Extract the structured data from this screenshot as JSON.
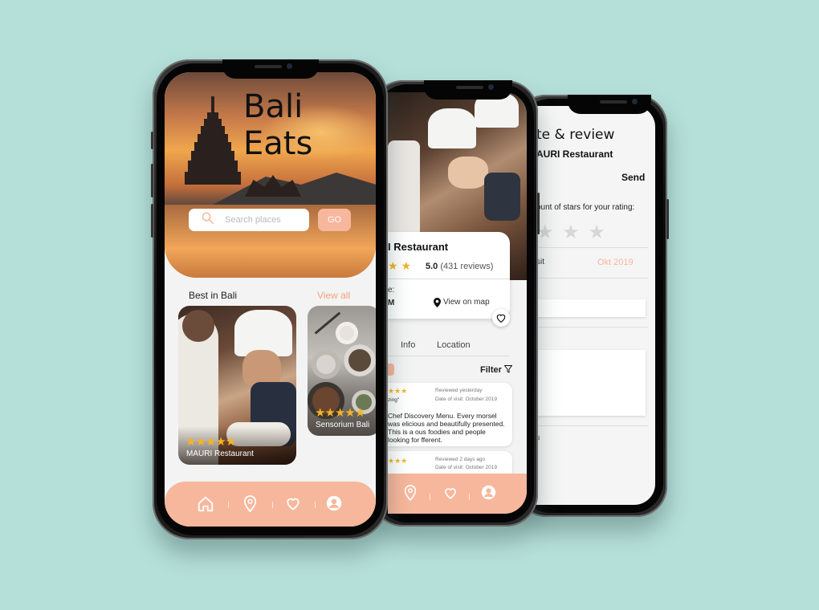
{
  "colors": {
    "background": "#b5dfd9",
    "accent": "#f7b79c",
    "accent_text": "#f5a27c",
    "star": "#f6b325"
  },
  "home": {
    "title_line1": "Bali",
    "title_line2": "Eats",
    "search": {
      "placeholder": "Search places",
      "icon": "search-icon",
      "go_label": "GO"
    },
    "section_title": "Best in Bali",
    "view_all": "View all",
    "cards": [
      {
        "name": "MAURI Restaurant",
        "stars": "★★★★★"
      },
      {
        "name": "Sensorium Bali",
        "stars": "★★★★★"
      }
    ],
    "tabbar": [
      "home-icon",
      "location-icon",
      "heart-icon",
      "profile-icon"
    ]
  },
  "detail": {
    "name": "I Restaurant",
    "stars": "★ ★",
    "score": "5.0",
    "reviews": "(431 reviews)",
    "me_label": "e:",
    "me_value": "M",
    "view_on_map": "View on map",
    "tabs": [
      "Info",
      "Location"
    ],
    "filter": "Filter",
    "review1": {
      "stars": "★★★",
      "meta1": "Reviewed yesterday",
      "meta2": "Date of visit: October 2019",
      "quote": "zing\"",
      "body": "Chef Discovery Menu. Every morsel was elicious and beautifully presented. This is a ous foodies and people looking for fferent."
    },
    "review2": {
      "stars": "★★★",
      "meta1": "Reviewed 2 days ago",
      "meta2": "Date of visit: October 2019"
    },
    "tabbar": [
      "location-icon",
      "heart-icon",
      "profile-icon"
    ]
  },
  "review": {
    "title": "te & review",
    "restaurant": "AURI Restaurant",
    "send": "Send",
    "prompt": "ount of stars for your rating:",
    "stars": "★ ★ ★",
    "visit_label": "sit",
    "visit_date": "Okt 2019",
    "trailing": "s"
  }
}
